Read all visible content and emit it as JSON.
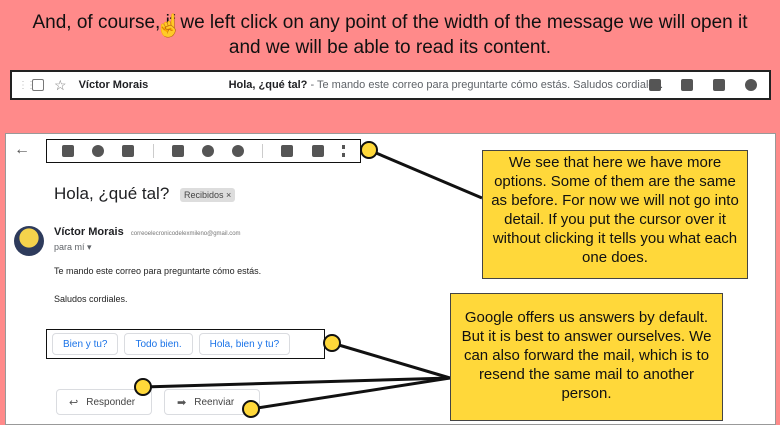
{
  "heading": {
    "line1": "And, of course, if we left click on any point of the width of the message we will open it",
    "line2": "and we will be able to read its content."
  },
  "inbox_row": {
    "sender": "Víctor Morais",
    "subject": "Hola, ¿qué tal?",
    "snippet": " - Te mando este correo para preguntarte cómo estás. Saludos cordiales.",
    "actions": [
      "archive-icon",
      "trash-icon",
      "mark-read-icon",
      "snooze-icon"
    ]
  },
  "email": {
    "toolbar_icons": [
      "archive-icon",
      "report-spam-icon",
      "delete-icon",
      "mark-unread-icon",
      "snooze-icon",
      "add-task-icon",
      "move-to-icon",
      "labels-icon",
      "more-icon"
    ],
    "title": "Hola, ¿qué tal?",
    "label_chip": "Recibidos ×",
    "sender_name": "Víctor Morais",
    "sender_email": "correoelecronicodelexmileno@gmail.com",
    "to": "para mí ▾",
    "body": [
      "Te mando este correo para preguntarte cómo estás.",
      "Saludos cordiales."
    ],
    "smart_replies": [
      "Bien y tu?",
      "Todo bien.",
      "Hola, bien y tu?"
    ],
    "reply_label": "Responder",
    "forward_label": "Reenviar"
  },
  "callouts": {
    "first": "We see that here we have more options. Some of them are the same as before. For now we will not go into detail. If you put the cursor over it without clicking it tells you what each one does.",
    "second": "Google offers us answers by default. But it is best to answer ourselves. We can also forward the mail, which is to resend the same mail to another person."
  },
  "colors": {
    "background": "#ff8a8a",
    "callout": "#ffd83a",
    "link_blue": "#1a73e8"
  }
}
